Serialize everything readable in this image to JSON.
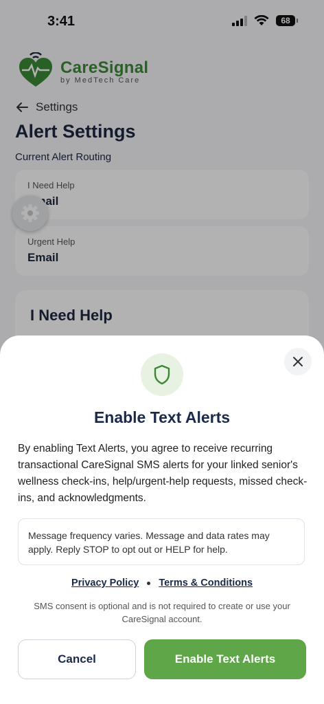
{
  "status_bar": {
    "time": "3:41",
    "battery": "68"
  },
  "brand": {
    "name": "CareSignal",
    "tagline": "by MedTech Care"
  },
  "nav": {
    "back_label": "Settings"
  },
  "page": {
    "title": "Alert Settings",
    "section_label": "Current Alert Routing",
    "routes": [
      {
        "label": "I Need Help",
        "value": "Email"
      },
      {
        "label": "Urgent Help",
        "value": "Email"
      }
    ],
    "help_card_title": "I Need Help"
  },
  "modal": {
    "title": "Enable Text Alerts",
    "body": "By enabling Text Alerts, you agree to receive recurring transactional CareSignal SMS alerts for your linked senior's wellness check-ins, help/urgent-help requests, missed check-ins, and acknowledgments.",
    "notice": "Message frequency varies. Message and data rates may apply. Reply STOP to opt out or HELP for help.",
    "privacy_link": "Privacy Policy",
    "terms_link": "Terms & Conditions",
    "consent_note": "SMS consent is optional and is not required to create or use your CareSignal account.",
    "cancel_label": "Cancel",
    "enable_label": "Enable Text Alerts"
  },
  "colors": {
    "brand_green": "#3a8a35",
    "button_green": "#5ea647",
    "navy": "#1b2a4a"
  },
  "icons": [
    "heart-logo-icon",
    "back-arrow-icon",
    "gear-icon",
    "close-icon",
    "shield-icon",
    "signal-icon",
    "wifi-icon",
    "battery-icon"
  ]
}
